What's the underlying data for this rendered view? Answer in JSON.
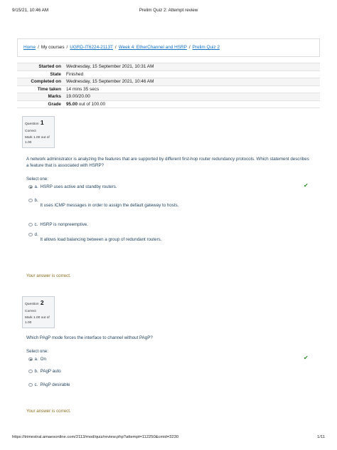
{
  "print_header": {
    "date": "9/15/21, 10:46 AM",
    "title": "Prelim Quiz 2: Attempt review"
  },
  "breadcrumb": {
    "home": "Home",
    "my_courses": "My courses",
    "course": "UGRD-IT6224-2113T",
    "week": "Week 4: EtherChannel and HSRP",
    "quiz": "Prelim Quiz 2"
  },
  "summary": [
    {
      "label": "Started on",
      "value": "Wednesday, 15 September 2021, 10:31 AM"
    },
    {
      "label": "State",
      "value": "Finished"
    },
    {
      "label": "Completed on",
      "value": "Wednesday, 15 September 2021, 10:46 AM"
    },
    {
      "label": "Time taken",
      "value": "14 mins 35 secs"
    },
    {
      "label": "Marks",
      "value": "19.00/20.00"
    },
    {
      "label": "Grade",
      "value_bold": "95.00",
      "value_rest": " out of 100.00"
    }
  ],
  "questions": [
    {
      "word": "Question",
      "number": "1",
      "status": "Correct",
      "mark": "Mark 1.00 out of 1.00",
      "text": "A network administrator is analyzing the features that are supported by different first-hop router redundancy protocols. Which statement describes a feature that is associated with HSRP?",
      "select_one": "Select one:",
      "options": [
        {
          "letter": "a.",
          "text": "HSRP uses active and standby routers."
        },
        {
          "letter": "b.",
          "text": "It uses ICMP messages in order to assign the default gateway to hosts."
        },
        {
          "letter": "c.",
          "text": "HSRP is nonpreemptive."
        },
        {
          "letter": "d.",
          "text": "It allows load balancing between a group of redundant routers."
        }
      ],
      "feedback": "Your answer is correct."
    },
    {
      "word": "Question",
      "number": "2",
      "status": "Correct",
      "mark": "Mark 1.00 out of 1.00",
      "text": "Which PAgP mode forces the interface to channel without PAgP?",
      "select_one": "Select one:",
      "options": [
        {
          "letter": "a.",
          "text": "On"
        },
        {
          "letter": "b.",
          "text": "PAgP auto"
        },
        {
          "letter": "c.",
          "text": "PAgP desirable"
        }
      ],
      "feedback": "Your answer is correct."
    }
  ],
  "check_mark": "✔",
  "print_footer": {
    "url": "https://trimestral.amaesonline.com/2113/mod/quiz/review.php?attempt=112250&cmid=3230",
    "page": "1/11"
  },
  "colors": {
    "link": "#0f6fc5",
    "question_text": "#1f3f5c",
    "feedback": "#8a6d1f",
    "check": "#2c8a2c"
  }
}
